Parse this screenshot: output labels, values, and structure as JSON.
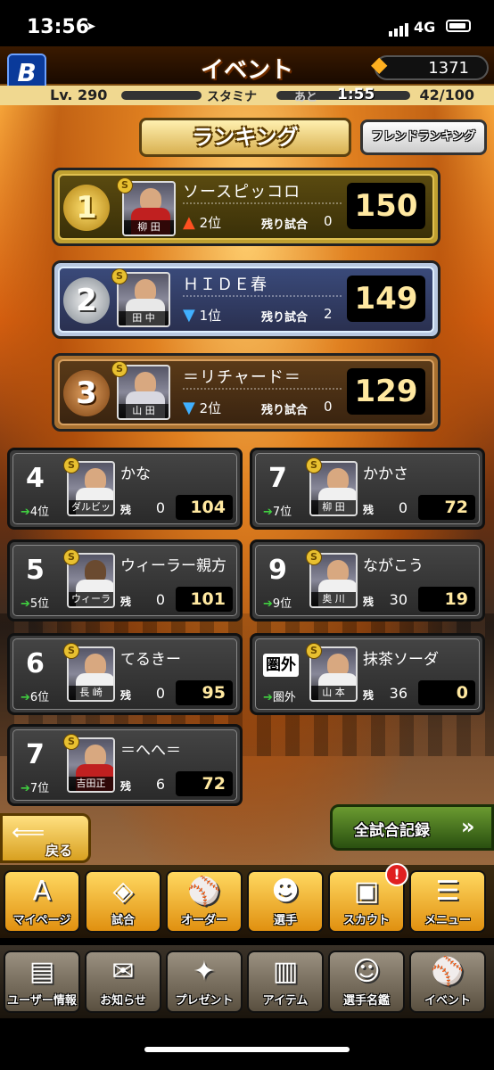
{
  "status": {
    "time": "13:56",
    "network": "4G"
  },
  "header": {
    "team_logo": "B",
    "title": "イベント",
    "coins": "1371"
  },
  "stamina": {
    "level": "Lv. 290",
    "label": "スタミナ",
    "ato": "あと",
    "timer": "1:55",
    "count": "42/100"
  },
  "ranking": {
    "title": "ランキング",
    "friend_button": "フレンドランキング"
  },
  "top3": [
    {
      "rank": "1",
      "name": "ソースピッコロ",
      "player": "柳 田",
      "prev": "2位",
      "trend": "up",
      "remain_label": "残り試合",
      "remain": "0",
      "score": "150"
    },
    {
      "rank": "2",
      "name": "ＨＩＤＥ春",
      "player": "田 中",
      "prev": "1位",
      "trend": "down",
      "remain_label": "残り試合",
      "remain": "2",
      "score": "149"
    },
    {
      "rank": "3",
      "name": "＝リチャード＝",
      "player": "山 田",
      "prev": "2位",
      "trend": "down",
      "remain_label": "残り試合",
      "remain": "0",
      "score": "129"
    }
  ],
  "others": [
    {
      "rank": "4",
      "name": "かな",
      "player": "ダルビッシュ",
      "prev": "4位",
      "remain_label": "残",
      "remain": "0",
      "score": "104"
    },
    {
      "rank": "5",
      "name": "ウィーラー親方",
      "player": "ウィーラー",
      "prev": "5位",
      "remain_label": "残",
      "remain": "0",
      "score": "101"
    },
    {
      "rank": "6",
      "name": "てるきー",
      "player": "長 崎",
      "prev": "6位",
      "remain_label": "残",
      "remain": "0",
      "score": "95"
    },
    {
      "rank": "7",
      "name": "＝へへ＝",
      "player": "吉田正",
      "prev": "7位",
      "remain_label": "残",
      "remain": "6",
      "score": "72"
    },
    {
      "rank": "7",
      "name": "かかさ",
      "player": "柳 田",
      "prev": "7位",
      "remain_label": "残",
      "remain": "0",
      "score": "72"
    },
    {
      "rank": "9",
      "name": "ながこう",
      "player": "奥 川",
      "prev": "9位",
      "remain_label": "残",
      "remain": "30",
      "score": "19"
    },
    {
      "rank": "圏外",
      "name": "抹茶ソーダ",
      "player": "山 本",
      "prev": "圏外",
      "remain_label": "残",
      "remain": "36",
      "score": "0"
    }
  ],
  "buttons": {
    "back": "戻る",
    "all_records": "全試合記録"
  },
  "menu_top": [
    {
      "label": "マイページ",
      "icon": "A"
    },
    {
      "label": "試合",
      "icon": "◈"
    },
    {
      "label": "オーダー",
      "icon": "⚾"
    },
    {
      "label": "選手",
      "icon": "☻"
    },
    {
      "label": "スカウト",
      "icon": "▣",
      "badge": "!"
    },
    {
      "label": "メニュー",
      "icon": "☰"
    }
  ],
  "menu_bottom": [
    {
      "label": "ユーザー情報",
      "icon": "▤"
    },
    {
      "label": "お知らせ",
      "icon": "✉"
    },
    {
      "label": "プレゼント",
      "icon": "✦"
    },
    {
      "label": "アイテム",
      "icon": "▥"
    },
    {
      "label": "選手名鑑",
      "icon": "☺"
    },
    {
      "label": "イベント",
      "icon": "⚾"
    }
  ]
}
